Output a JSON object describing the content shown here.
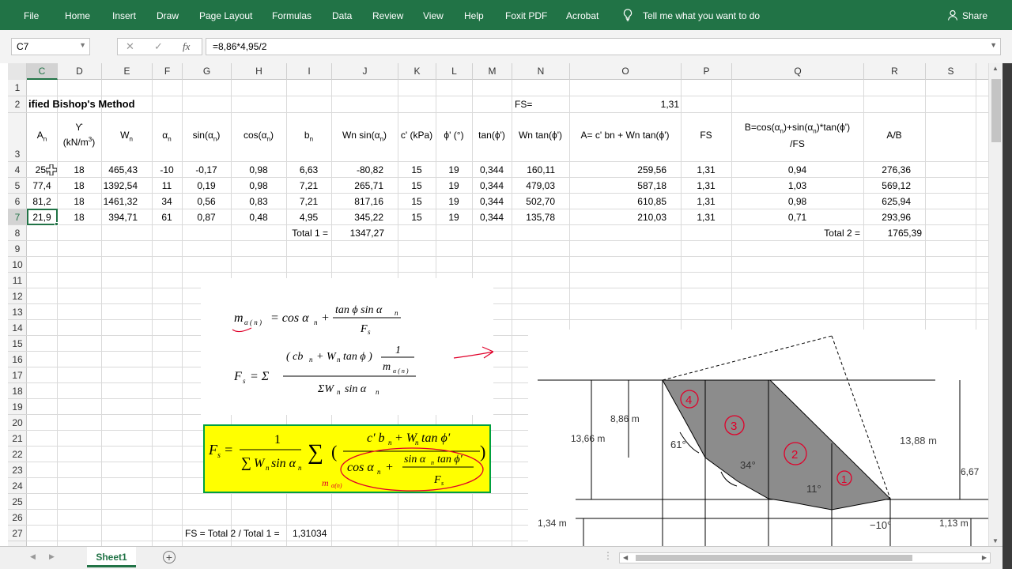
{
  "ribbon": {
    "tabs": [
      "File",
      "Home",
      "Insert",
      "Draw",
      "Page Layout",
      "Formulas",
      "Data",
      "Review",
      "View",
      "Help",
      "Foxit PDF",
      "Acrobat"
    ],
    "tell_me": "Tell me what you want to do",
    "share": "Share"
  },
  "formula_bar": {
    "name_box": "C7",
    "formula": "=8,86*4,95/2"
  },
  "columns": [
    "C",
    "D",
    "E",
    "F",
    "G",
    "H",
    "I",
    "J",
    "K",
    "L",
    "M",
    "N",
    "O",
    "P",
    "Q",
    "R",
    "S"
  ],
  "selected_column": "C",
  "rows": [
    "1",
    "2",
    "3",
    "4",
    "5",
    "6",
    "7",
    "8",
    "9",
    "10",
    "11",
    "12",
    "13",
    "14",
    "15",
    "16",
    "17",
    "18",
    "19",
    "20",
    "21",
    "22",
    "23",
    "24",
    "25",
    "26",
    "27"
  ],
  "selected_row": "7",
  "sheet": {
    "title": "ified Bishop's Method",
    "fs_label": "FS=",
    "fs_value": "1,31",
    "data_rows": [
      [
        "25,",
        "18",
        "465,43",
        "-10",
        "-0,17",
        "0,98",
        "6,63",
        "-80,82",
        "15",
        "19",
        "0,344",
        "160,11",
        "259,56",
        "1,31",
        "0,94",
        "276,36"
      ],
      [
        "77,4",
        "18",
        "1392,54",
        "11",
        "0,19",
        "0,98",
        "7,21",
        "265,71",
        "15",
        "19",
        "0,344",
        "479,03",
        "587,18",
        "1,31",
        "1,03",
        "569,12"
      ],
      [
        "81,2",
        "18",
        "1461,32",
        "34",
        "0,56",
        "0,83",
        "7,21",
        "817,16",
        "15",
        "19",
        "0,344",
        "502,70",
        "610,85",
        "1,31",
        "0,98",
        "625,94"
      ],
      [
        "21,9",
        "18",
        "394,71",
        "61",
        "0,87",
        "0,48",
        "4,95",
        "345,22",
        "15",
        "19",
        "0,344",
        "135,78",
        "210,03",
        "1,31",
        "0,71",
        "293,96"
      ]
    ],
    "total1_label": "Total 1 =",
    "total1_value": "1347,27",
    "total2_label": "Total 2 =",
    "total2_value": "1765,39",
    "fs_result_label": "FS = Total 2 / Total 1 =",
    "fs_result_value": "1,31034"
  },
  "diagram_labels": {
    "h886": "8,86  m",
    "h1366": "13,66  m",
    "h1388": "13,88  m",
    "h667": "6,67",
    "h134": "1,34  m",
    "h113": "1,13  m",
    "a61": "61°",
    "a34": "34°",
    "a11": "11°",
    "am10": "−10°",
    "s1": "1",
    "s2": "2",
    "s3": "3",
    "s4": "4"
  },
  "sheet_tab": "Sheet1",
  "colors": {
    "ribbon": "#217346",
    "highlight": "#ffff00",
    "annotation": "#e0002a"
  }
}
